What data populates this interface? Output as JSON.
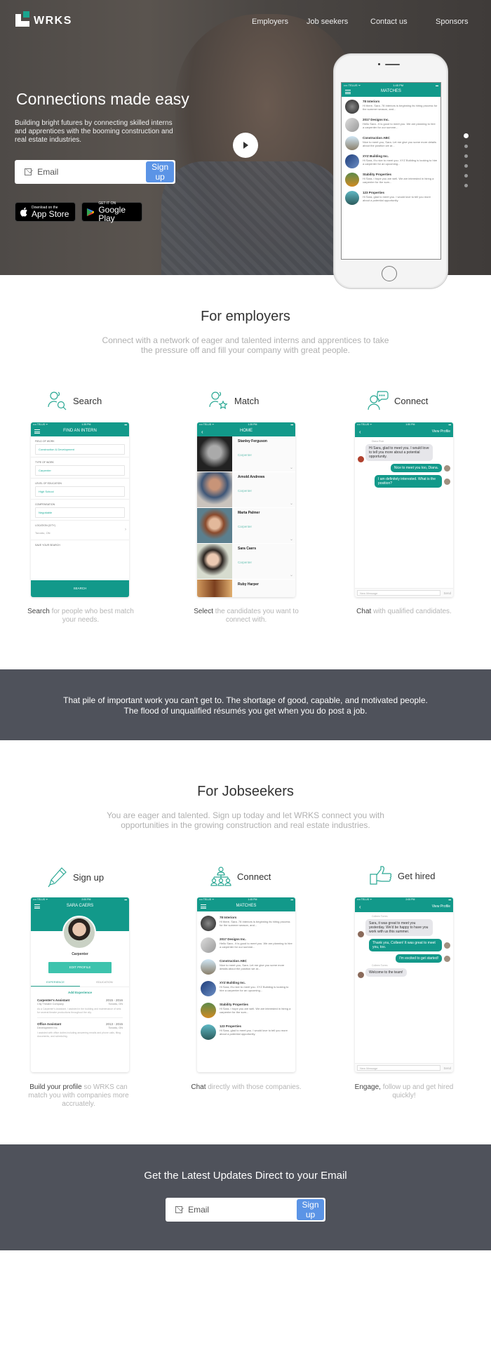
{
  "brand": {
    "name": "WRKS",
    "accent": "#1aa58e",
    "button_color": "#5b94e6",
    "dark_band": "#4f525b"
  },
  "nav": {
    "items": [
      "Employers",
      "Job seekers",
      "Contact us",
      "Sponsors"
    ]
  },
  "hero": {
    "title": "Connections made easy",
    "subtitle": "Building bright futures by connecting skilled interns and apprentices with the booming construction and real estate industries.",
    "email_placeholder": "Email",
    "signup_label": "Sign up",
    "appstore": {
      "small": "Download on the",
      "large": "App Store"
    },
    "googleplay": {
      "small": "GET IT ON",
      "large": "Google Play"
    },
    "carousel": {
      "total": 6,
      "active": 1
    },
    "phone": {
      "status_left": "•••• TELUS ᯤ",
      "status_time": "1:45 PM",
      "title": "MATCHES"
    }
  },
  "matches": [
    {
      "name": "78 Interiors",
      "text": "Hi there, Sara. 78 Interiors is beginning its hiring process for the summer season, and..."
    },
    {
      "name": "2017 Designs Inc.",
      "text": "Hello Sara - it is good to meet you. We are planning to hire a carpenter for our summe..."
    },
    {
      "name": "Construction ABC",
      "text": "Nice to meet you, Sara. Let me give you some more details about the position we ar..."
    },
    {
      "name": "XYZ Building Inc.",
      "text": "Hi Sara, it's nice to meet you. XYZ Building is looking to hire a carpenter for an upcoming..."
    },
    {
      "name": "Stability Properties",
      "text": "Hi Sara, I hope you are well. We are interested in hiring a carpenter for the sum..."
    },
    {
      "name": "123 Properties",
      "text": "Hi Sara, glad to meet you. I would love to tell you more about a potential opportunity."
    }
  ],
  "employers": {
    "title": "For employers",
    "subtitle": "Connect with a network of eager and talented interns and apprentices to take the pressure off and fill your company with great people.",
    "features": [
      {
        "label": "Search",
        "caption_bold": "Search",
        "caption_rest": " for people who best match your needs."
      },
      {
        "label": "Match",
        "caption_bold": "Select",
        "caption_rest": " the candidates you want to connect with."
      },
      {
        "label": "Connect",
        "caption_bold": "Chat",
        "caption_rest": " with qualified candidates."
      }
    ],
    "search_screen": {
      "status_left": "•••• TELUS ᯤ",
      "status_time": "1:35 PM",
      "title": "FIND AN INTERN",
      "fields": [
        {
          "label": "FIELD OF WORK",
          "value": "Construction & Development"
        },
        {
          "label": "TYPE OF WORK",
          "value": "Carpenter"
        },
        {
          "label": "LEVEL OF EDUCATION",
          "value": "High School"
        },
        {
          "label": "COMPENSATION",
          "value": "Negotiable"
        }
      ],
      "location_label": "LOCATION (CITY)",
      "location_value": "Toronto, ON",
      "save_label": "SAVE YOUR SEARCH",
      "button": "SEARCH"
    },
    "match_screen": {
      "status_left": "•••• TELUS ᯤ",
      "status_time": "1:35 PM",
      "title": "HOME",
      "candidates": [
        {
          "name": "Stanley Ferguson",
          "role": "Carpenter"
        },
        {
          "name": "Arnold Andrews",
          "role": "Carpenter"
        },
        {
          "name": "Marta Palmer",
          "role": "Carpenter"
        },
        {
          "name": "Sara Caers",
          "role": "Carpenter"
        },
        {
          "name": "Ruby Harper",
          "role": ""
        }
      ]
    },
    "chat_screen": {
      "status_left": "•••• TELUS ᯤ",
      "status_time": "1:50 PM",
      "right": "View Profile",
      "sender": "Diana Ruiz",
      "messages": [
        {
          "dir": "in",
          "text": "Hi Sara, glad to meet you. I would love to tell you more about a potential opportunity."
        },
        {
          "dir": "out",
          "text": "Nice to meet you too, Diana."
        },
        {
          "dir": "out",
          "text": "I am definitely interested. What is the position?"
        }
      ],
      "input_placeholder": "New Message",
      "send": "Send"
    }
  },
  "quote": "That pile of important work you can't get to. The shortage of good, capable, and motivated people. The flood of unqualified résumés you get when you do post a job.",
  "jobseekers": {
    "title": "For Jobseekers",
    "subtitle": "You are eager and talented. Sign up today and let WRKS connect you with opportunities in the growing construction and real estate industries.",
    "features": [
      {
        "label": "Sign up",
        "caption_bold": "Build your profile",
        "caption_rest": " so WRKS can match you with companies more accruately."
      },
      {
        "label": "Connect",
        "caption_bold": "Chat",
        "caption_rest": " directly with those companies."
      },
      {
        "label": "Get hired",
        "caption_bold": "Engage,",
        "caption_rest": " follow up and get hired quickly!"
      }
    ],
    "profile_screen": {
      "status_left": "•••• TELUS ᯤ",
      "status_time": "2:00 PM",
      "title": "SARA CAERS",
      "role": "Carpenter",
      "edit": "EDIT PROFILE",
      "tabs": [
        "EXPERIENCE",
        "EDUCATION"
      ],
      "add": "Add Experience",
      "experience": [
        {
          "title": "Carpenter's Assistant",
          "years": "2015 - 2016",
          "company": "City Theatre Company",
          "location": "Toronto, ON",
          "desc": "As a Carpenter's Assistant, I assisted in the building and maintenance of sets for several theatre productions throughout the city."
        },
        {
          "title": "Office Assistant",
          "years": "2013 - 2015",
          "company": "Development Inc.",
          "location": "Toronto, ON",
          "desc": "I assisted with office duties including answering emails and phone calls, filing documents, and scheduling."
        }
      ]
    },
    "matches_screen": {
      "status_left": "•••• TELUS ᯤ",
      "status_time": "1:45 PM",
      "title": "MATCHES"
    },
    "hired_screen": {
      "status_left": "•••• TELUS ᯤ",
      "status_time": "2:05 PM",
      "right": "View Profile",
      "sender": "Colleen Torres",
      "messages": [
        {
          "dir": "in",
          "text": "Sara, it was great to meet you yesterday. We'd be happy to have you work with us this summer."
        },
        {
          "dir": "out",
          "text": "Thank you, Colleen! It was great to meet you, too."
        },
        {
          "dir": "out",
          "text": "I'm excited to get started!"
        },
        {
          "dir": "in",
          "text": "Welcome to the team!"
        }
      ],
      "input_placeholder": "New Message",
      "send": "Send"
    }
  },
  "newsletter": {
    "title": "Get the Latest Updates Direct to your Email",
    "email_placeholder": "Email",
    "signup_label": "Sign up"
  }
}
